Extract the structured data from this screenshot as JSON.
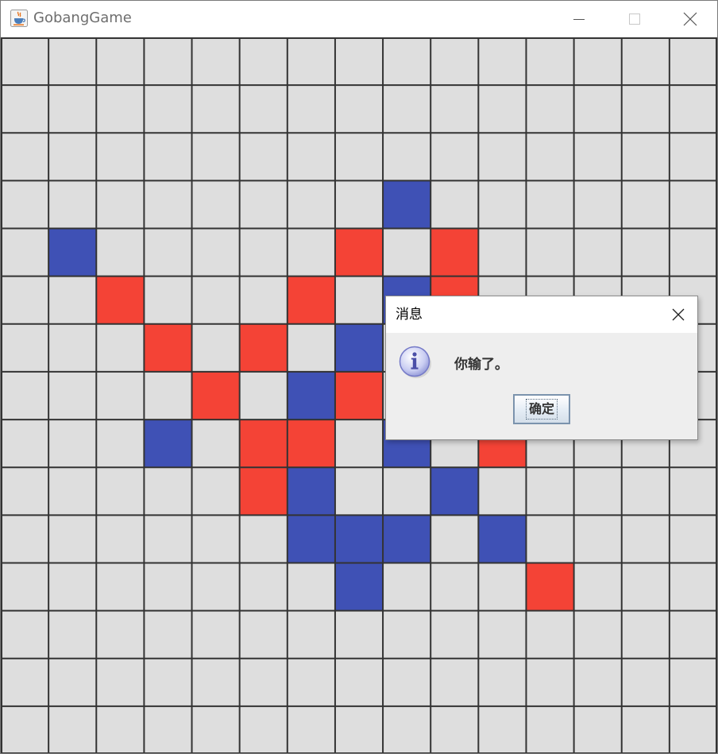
{
  "window": {
    "title": "GobangGame",
    "icon": "java-cup-icon",
    "controls": [
      "minimize-icon",
      "maximize-icon",
      "close-icon"
    ]
  },
  "board": {
    "size": 15,
    "colors": {
      "cell": "#dedede",
      "grid": "#333333",
      "blue": "#3f51b5",
      "red": "#f44336"
    },
    "blue_stones": [
      [
        3,
        8
      ],
      [
        4,
        1
      ],
      [
        5,
        8
      ],
      [
        6,
        7
      ],
      [
        7,
        6
      ],
      [
        8,
        3
      ],
      [
        8,
        8
      ],
      [
        9,
        6
      ],
      [
        9,
        9
      ],
      [
        10,
        6
      ],
      [
        10,
        7
      ],
      [
        10,
        8
      ],
      [
        10,
        10
      ],
      [
        11,
        7
      ]
    ],
    "red_stones": [
      [
        4,
        7
      ],
      [
        4,
        9
      ],
      [
        5,
        2
      ],
      [
        5,
        6
      ],
      [
        5,
        9
      ],
      [
        6,
        3
      ],
      [
        6,
        5
      ],
      [
        7,
        4
      ],
      [
        7,
        7
      ],
      [
        8,
        5
      ],
      [
        8,
        6
      ],
      [
        8,
        10
      ],
      [
        9,
        5
      ],
      [
        11,
        11
      ]
    ]
  },
  "dialog": {
    "title": "消息",
    "message": "你输了。",
    "ok_label": "确定",
    "icon": "information-icon"
  }
}
